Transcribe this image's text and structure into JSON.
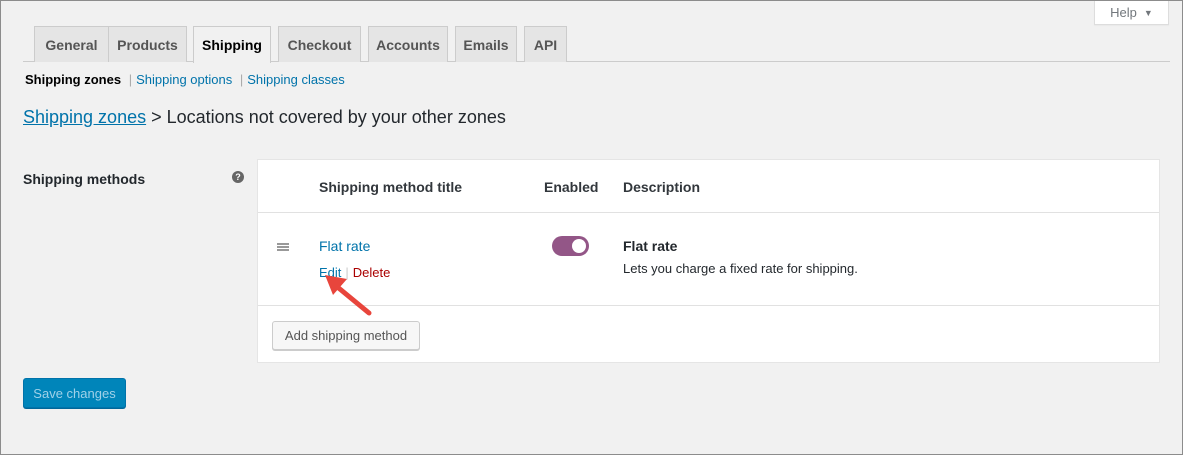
{
  "help": {
    "label": "Help",
    "caret": "▼"
  },
  "tabs": [
    {
      "label": "General"
    },
    {
      "label": "Products"
    },
    {
      "label": "Shipping",
      "active": true
    },
    {
      "label": "Checkout"
    },
    {
      "label": "Accounts"
    },
    {
      "label": "Emails"
    },
    {
      "label": "API"
    }
  ],
  "subnav": {
    "current": "Shipping zones",
    "links": [
      "Shipping options",
      "Shipping classes"
    ],
    "separator": "|"
  },
  "breadcrumb": {
    "link": "Shipping zones",
    "separator": ">",
    "title": "Locations not covered by your other zones"
  },
  "section": {
    "label": "Shipping methods",
    "help_tip": "?"
  },
  "table": {
    "headers": {
      "title": "Shipping method title",
      "enabled": "Enabled",
      "description": "Description"
    },
    "rows": [
      {
        "title": "Flat rate",
        "actions": {
          "edit": "Edit",
          "separator": "|",
          "delete": "Delete"
        },
        "enabled": true,
        "description_title": "Flat rate",
        "description_text": "Lets you charge a fixed rate for shipping."
      }
    ]
  },
  "add_method_label": "Add shipping method",
  "save_label": "Save changes",
  "colors": {
    "link": "#0073aa",
    "toggle_on": "#935687",
    "primary_button": "#0085ba",
    "delete": "#a00",
    "annotation_arrow": "#e8453c"
  },
  "icons": {
    "drag": "drag-handle-icon",
    "help": "help-tip-icon",
    "arrow": "annotation-arrow-icon"
  }
}
